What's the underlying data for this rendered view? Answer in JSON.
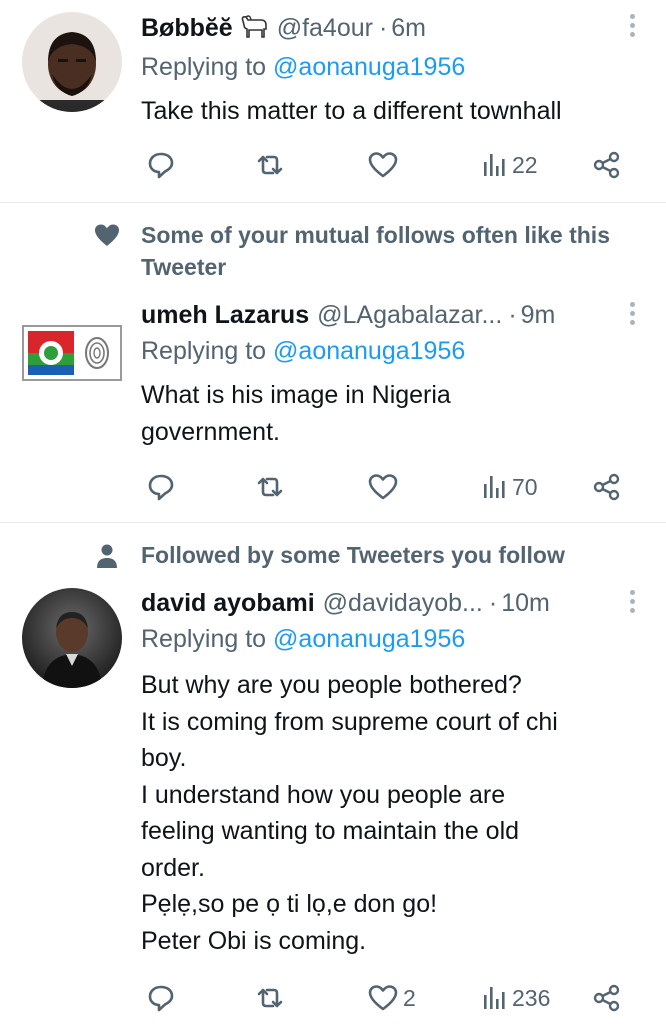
{
  "replying_label": "Replying to",
  "tweets": [
    {
      "name": "Bøbbĕĕ",
      "handle": "@fa4our",
      "sep": "·",
      "time": "6m",
      "reply_to": "@aonanuga1956",
      "lines": [
        "Take this matter to a different townhall"
      ],
      "stats": {
        "views": "22",
        "likes": ""
      }
    },
    {
      "social_context": [
        "Some of your mutual follows often like this",
        "Tweeter"
      ],
      "social_icon": "heart-icon",
      "name": "umeh Lazarus",
      "handle": "@LAgabalazar...",
      "sep": "·",
      "time": "9m",
      "reply_to": "@aonanuga1956",
      "lines": [
        "What is his image in Nigeria",
        "government."
      ],
      "stats": {
        "views": "70",
        "likes": ""
      }
    },
    {
      "social_context": [
        "Followed by some Tweeters you follow"
      ],
      "social_icon": "person-icon",
      "name": "david ayobami",
      "handle": "@davidayob...",
      "sep": "·",
      "time": "10m",
      "reply_to": "@aonanuga1956",
      "lines": [
        "But why are you people bothered?",
        "It is coming from supreme court of chi",
        "boy.",
        "I understand how you people are",
        "feeling wanting to maintain the old",
        "order.",
        "Pẹlẹ,so pe ọ ti lọ,e don go!",
        "Peter Obi is coming."
      ],
      "stats": {
        "views": "236",
        "likes": "2"
      }
    }
  ],
  "colors": {
    "link": "#1d9bf0",
    "secondary": "#536471",
    "text": "#0f1419"
  }
}
